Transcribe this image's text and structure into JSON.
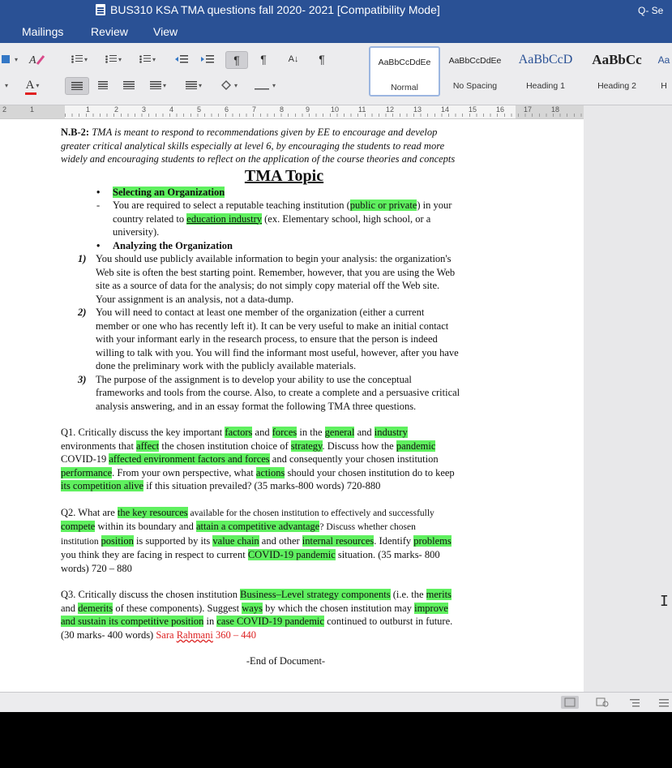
{
  "window": {
    "title": "BUS310 KSA TMA questions fall 2020- 2021 [Compatibility Mode]",
    "search_label": "Q- Se"
  },
  "menu": [
    "Mailings",
    "Review",
    "View"
  ],
  "ribbon": {
    "font_color_glyph": "A",
    "sort_glyph": "A↓",
    "pilcrow_glyph": "¶",
    "styles": [
      {
        "preview": "AaBbCcDdEe",
        "name": "Normal"
      },
      {
        "preview": "AaBbCcDdEe",
        "name": "No Spacing"
      },
      {
        "preview": "AaBbCcD",
        "name": "Heading 1"
      },
      {
        "preview": "AaBbCc",
        "name": "Heading 2"
      },
      {
        "preview": "Aa",
        "name": "H"
      }
    ]
  },
  "ruler": {
    "numbers": [
      "2",
      "1",
      "1",
      "2",
      "3",
      "4",
      "5",
      "6",
      "7",
      "8",
      "9",
      "10",
      "11",
      "12",
      "13",
      "14",
      "15",
      "16",
      "17",
      "18"
    ]
  },
  "doc": {
    "nb_label": "N.B-2:",
    "nb_text_1": " TMA is meant to respond to recommendations given by EE to encourage and develop",
    "nb_text_2": "greater critical analytical skills especially at level 6, by encouraging the students to read more",
    "nb_text_3": "widely and encouraging students to reflect on the application of the course theories and concepts",
    "topic": "TMA Topic",
    "bullet_mark": "•",
    "dash_mark": "-",
    "sec1_title": "Selecting an Organization",
    "sec1_a": "You are required to select a reputable teaching institution (",
    "sec1_hl1": "public or private",
    "sec1_b": ") in your",
    "sec1_c": "country related to ",
    "sec1_hl2": "education industry",
    "sec1_d": " (ex. Elementary school, high school, or a",
    "sec1_e": "university).",
    "sec2_title": "Analyzing the Organization",
    "items": [
      {
        "mark": "1)",
        "lines": [
          "You should use publicly available information to begin your analysis: the organization's",
          "Web site is often the best starting point. Remember, however, that you are using the Web",
          "site as a source of data for the analysis; do not simply copy material off the Web site.",
          "Your assignment is an analysis, not a data-dump."
        ]
      },
      {
        "mark": "2)",
        "lines": [
          "You will need to contact at least one member of the organization (either a current",
          "member or one who has recently left it). It can be very useful to make an initial contact",
          "with your informant early in the research process, to ensure that the person is indeed",
          "willing to talk with you. You will find the informant most useful, however, after you have",
          "done the preliminary work with the publicly available materials."
        ]
      },
      {
        "mark": "3)",
        "lines": [
          "The purpose of the assignment is to develop your ability to use the conceptual",
          "frameworks and tools from the course. Also, to create a complete and a persuasive critical",
          "analysis answering, and in an essay format the following TMA three questions."
        ]
      }
    ],
    "q1": {
      "t1": "Q1. Critically discuss the key important ",
      "h1": "factors",
      "t2": " and ",
      "h2": "forces",
      "t3": " in the ",
      "h3": "general",
      "t4": " and ",
      "h4": "industry",
      "t5": "environments that ",
      "h5": "affect",
      "t6": " the chosen institution choice of ",
      "h6": "strategy",
      "t7": ". Discuss how the ",
      "h7": "pandemic",
      "t8": "COVID-19 ",
      "h8": "affected environment factors and forces",
      "t9": " and consequently your chosen institution",
      "h9": "performance",
      "t10": ". From your own perspective, what ",
      "h10": "actions",
      "t11": " should your chosen institution do to keep",
      "h11": "its competition alive",
      "t12": " if this situation prevailed? (35 marks-800 words) 720-880"
    },
    "q2": {
      "t1": "Q2. What are ",
      "h1": "the key resources",
      "t2": " available for the chosen institution to effectively and successfully",
      "h2": "compete",
      "t3": " within its boundary and ",
      "h3": "attain a competitive advantage",
      "t4": "? Discuss whether chosen",
      "t5": "institution ",
      "h4": "position",
      "t6": " is supported by its ",
      "h5": "value chain",
      "t7": " and other ",
      "h6": "internal resources",
      "t8": ". Identify ",
      "h7": "problems",
      "t9": "you think they are facing in respect to current ",
      "h8": "COVID-19 pandemic",
      "t10": " situation.  (35 marks- 800",
      "t11": "words) 720 – 880"
    },
    "q3": {
      "t1": "Q3. Critically discuss the chosen institution ",
      "h1": "Business–Level strategy components",
      "t2": " (i.e. the ",
      "h2": "merits",
      "t3": "and ",
      "h3": "demerits",
      "t4": " of these components). Suggest ",
      "h4": "ways",
      "t5": " by which the chosen institution may ",
      "h5": "improve",
      "h6": "and sustain its competitive position",
      "t6": " in ",
      "h7": "case COVID-19 pandemic",
      "t7": " continued to outburst in future.",
      "t8": "(30 marks- 400 words) ",
      "r1": "Sara ",
      "r2": "Rahmani",
      "r3": " 360 – 440"
    },
    "end": "-End of Document-"
  },
  "colors": {
    "titlebar": "#2a5195",
    "highlight": "#5ff05f",
    "red_text": "#d22222"
  }
}
